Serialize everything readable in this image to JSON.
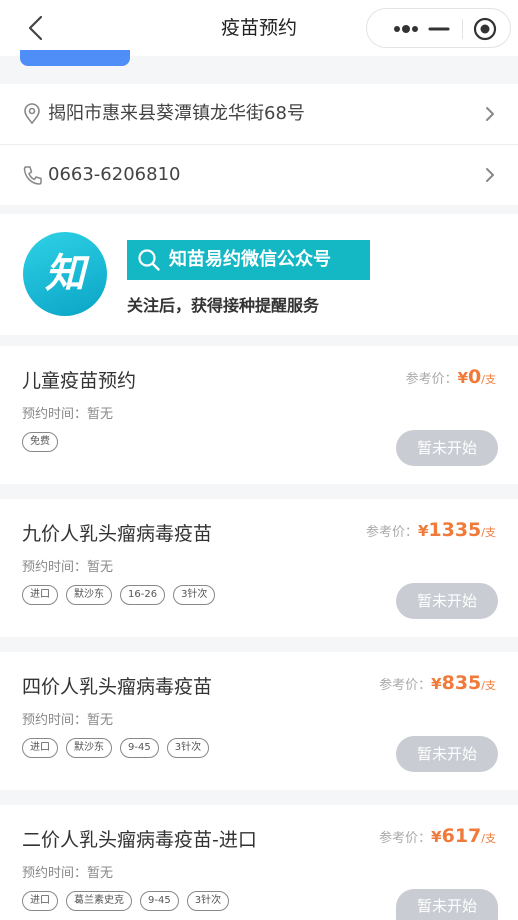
{
  "navbar": {
    "title": "疫苗预约"
  },
  "contact": {
    "address": "揭阳市惠来县葵潭镇龙华街68号",
    "phone": "0663-6206810"
  },
  "promo": {
    "logo_text": "知",
    "badge": "知苗易约微信公众号",
    "subtitle": "关注后，获得接种提醒服务"
  },
  "vaccines": [
    {
      "name": "儿童疫苗预约",
      "time": "预约时间：暂无",
      "price_label": "参考价：",
      "currency": "¥",
      "price": "0",
      "unit": "/支",
      "tags": [
        "免费"
      ],
      "button": "暂未开始"
    },
    {
      "name": "九价人乳头瘤病毒疫苗",
      "time": "预约时间：暂无",
      "price_label": "参考价：",
      "currency": "¥",
      "price": "1335",
      "unit": "/支",
      "tags": [
        "进口",
        "默沙东",
        "16-26",
        "3针次"
      ],
      "button": "暂未开始"
    },
    {
      "name": "四价人乳头瘤病毒疫苗",
      "time": "预约时间：暂无",
      "price_label": "参考价：",
      "currency": "¥",
      "price": "835",
      "unit": "/支",
      "tags": [
        "进口",
        "默沙东",
        "9-45",
        "3针次"
      ],
      "button": "暂未开始"
    },
    {
      "name": "二价人乳头瘤病毒疫苗-进口",
      "time": "预约时间：暂无",
      "price_label": "参考价：",
      "currency": "¥",
      "price": "617",
      "unit": "/支",
      "tags": [
        "进口",
        "葛兰素史克",
        "9-45",
        "3针次"
      ],
      "button": "暂未开始"
    }
  ],
  "colors": {
    "accent_blue": "#4f8ef7",
    "promo_teal": "#14b7c4",
    "price_orange": "#f07a3a",
    "disabled_button": "#c9ccd3"
  },
  "icons": {
    "back": "chevron-left-icon",
    "more": "more-dots-icon",
    "minimize": "minimize-icon",
    "close": "target-close-icon",
    "location": "location-pin-icon",
    "phone": "phone-icon",
    "search": "search-icon",
    "arrow": "chevron-right-icon"
  }
}
